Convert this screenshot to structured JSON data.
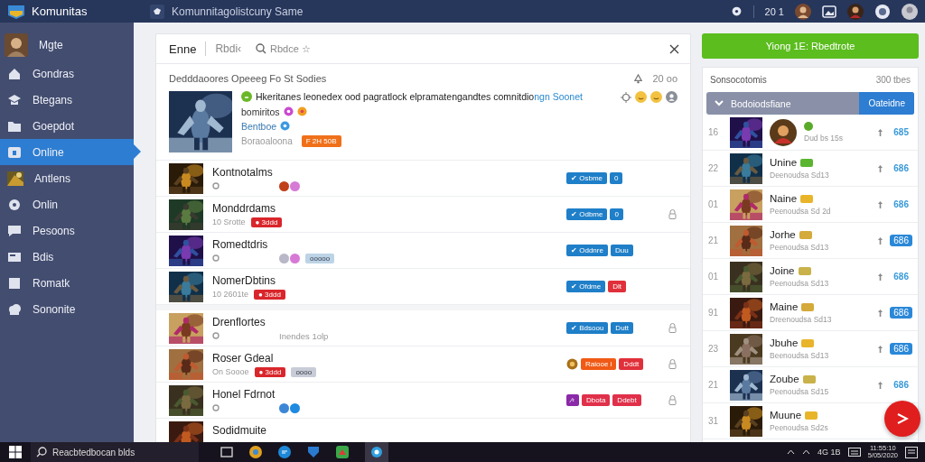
{
  "topbar": {
    "brand": "Komunitas",
    "search": "Komunnitagolistcuny Same",
    "count": "20 1"
  },
  "sidebar": {
    "items": [
      {
        "label": "Mgte",
        "selected": false
      },
      {
        "label": "Gondras",
        "selected": false
      },
      {
        "label": "Btegans",
        "selected": false
      },
      {
        "label": "Goepdot",
        "selected": false
      },
      {
        "label": "Online",
        "selected": true
      },
      {
        "label": "Antlens",
        "selected": false
      },
      {
        "label": "Onlin",
        "selected": false
      },
      {
        "label": "Pesoons",
        "selected": false
      },
      {
        "label": "Bdis",
        "selected": false
      },
      {
        "label": "Romatk",
        "selected": false
      },
      {
        "label": "Sononite",
        "selected": false
      }
    ]
  },
  "feed": {
    "tabs": [
      {
        "label": "Enne",
        "selected": true
      },
      {
        "label": "Rbdi‹",
        "selected": false
      }
    ],
    "search": {
      "placeholder": "Rbdce ☆"
    },
    "heading": "Dedddaoores Opeeeg Fo St Sodies",
    "time": "20 oo",
    "post": {
      "text": "Hkeritanes leonedex ood pagratlock elpramatengandtes comnitdio",
      "link": "ngn Soonet",
      "line2": "bomiritos",
      "line3": "Bentboe",
      "line4": "Boraoaloona",
      "badge": "F 2H 50B"
    },
    "groups": [
      [
        {
          "title": "Kontnotalms",
          "pin": true,
          "reactions": [
            {
              "color": "#c0401a"
            },
            {
              "color": "#d67ad6"
            }
          ],
          "tags": [
            {
              "text": "✔ Osbme",
              "color": "#1f7fc8"
            },
            {
              "text": "0",
              "color": "#1f7fc8"
            }
          ],
          "emblem": false,
          "locked": false
        },
        {
          "title": "Monddrdams",
          "pin": false,
          "meta": "10 Srotte",
          "meta_badges": [
            {
              "text": "● 3ddd",
              "color": "#d9262b"
            }
          ],
          "tags": [
            {
              "text": "✔ Odbme",
              "color": "#1f7fc8"
            },
            {
              "text": "0",
              "color": "#1f7fc8"
            }
          ],
          "emblem": false,
          "locked": true
        },
        {
          "title": "Romedtdris",
          "pin": true,
          "reactions": [
            {
              "color": "#b8b8c8"
            },
            {
              "color": "#d67ad6"
            }
          ],
          "meta_badges": [
            {
              "text": "ooooo",
              "color": "#bcd4e6"
            }
          ],
          "tags": [
            {
              "text": "✔ Oddnre",
              "color": "#1f7fc8"
            },
            {
              "text": "Duu",
              "color": "#1f7fc8"
            }
          ],
          "emblem": false,
          "locked": false
        },
        {
          "title": "NomerDbtins",
          "pin": false,
          "meta": "10 2601te",
          "meta_badges": [
            {
              "text": "● 3ddd",
              "color": "#d9262b"
            }
          ],
          "tags": [
            {
              "text": "✔ Ofdme",
              "color": "#1f7fc8"
            },
            {
              "text": "Dlt",
              "color": "#e0303a"
            }
          ],
          "emblem": false,
          "locked": false
        }
      ],
      [
        {
          "title": "Drenflortes",
          "pin": true,
          "note": "Inendes 1olp",
          "tags": [
            {
              "text": "✔ Bdsoou",
              "color": "#1f7fc8"
            },
            {
              "text": "Dutt",
              "color": "#1f7fc8"
            }
          ],
          "emblem": false,
          "locked": true
        },
        {
          "title": "Roser Gdeal",
          "pin": false,
          "meta": "On Soooe",
          "meta_badges": [
            {
              "text": "● 3ddd",
              "color": "#d9262b"
            },
            {
              "text": "oooo",
              "color": "#c8ccd6"
            }
          ],
          "tags": [
            {
              "text": "Raiooe i",
              "color": "#f05a16"
            },
            {
              "text": "Dddt",
              "color": "#e0303a"
            }
          ],
          "emblem": true,
          "locked": true
        },
        {
          "title": "Honel Fdrnot",
          "pin": true,
          "reactions": [
            {
              "color": "#3d86d6"
            },
            {
              "color": "#1f8ae0"
            }
          ],
          "tags": [
            {
              "text": "⁄‹",
              "color": "#8a2aa8"
            },
            {
              "text": "Dbota",
              "color": "#e0304a"
            },
            {
              "text": "Ddebt",
              "color": "#e0304a"
            }
          ],
          "emblem": false,
          "locked": true
        },
        {
          "title": "Sodidmuite",
          "pin": false,
          "emblem": false,
          "locked": false
        }
      ]
    ]
  },
  "cta": {
    "label": "Yiong 1E: Rbedtrote"
  },
  "ranking": {
    "title": "Sonsocotomis",
    "count": "300 tbes",
    "group": {
      "label": "Bodoiodsfiane",
      "expanded": true,
      "action": "Oateidne"
    },
    "rows": [
      {
        "kind": "featured",
        "rank": "16",
        "sub": "Dud bs 15s",
        "value": "685",
        "pill": false
      },
      {
        "kind": "player",
        "rank": "22",
        "name": "Unine",
        "color": "#5bb531",
        "sub": "Deenoudsa Sd13",
        "value": "686",
        "pill": false
      },
      {
        "kind": "player",
        "rank": "01",
        "name": "Naine",
        "color": "#e8b52a",
        "sub": "Peenoudsa Sd 2d",
        "value": "686",
        "pill": false
      },
      {
        "kind": "player",
        "rank": "21",
        "name": "Jorhe",
        "color": "#d4aa3a",
        "sub": "Peenoudsa Sd13",
        "value": "686",
        "pill": true
      },
      {
        "kind": "player",
        "rank": "01",
        "name": "Joine",
        "color": "#c9b24a",
        "sub": "Peenoudsa Sd13",
        "value": "686",
        "pill": false
      },
      {
        "kind": "player",
        "rank": "91",
        "name": "Maine",
        "color": "#d4aa3a",
        "sub": "Dreenoudsa Sd13",
        "value": "686",
        "pill": true
      },
      {
        "kind": "player",
        "rank": "23",
        "name": "Jbuhe",
        "color": "#e8b52a",
        "sub": "Beenoudsa Sd13",
        "value": "686",
        "pill": true
      },
      {
        "kind": "player",
        "rank": "21",
        "name": "Zoube",
        "color": "#c9b24a",
        "sub": "Peenoudsa Sd15",
        "value": "686",
        "pill": false
      },
      {
        "kind": "player",
        "rank": "31",
        "name": "Muune",
        "color": "#e8b52a",
        "sub": "Peenoudsa Sd2s"
      }
    ]
  },
  "taskbar": {
    "search": "Reacbtedbocan blds",
    "tray": "4G 1B",
    "time": "11:55:10",
    "date": "5/05/2020"
  }
}
